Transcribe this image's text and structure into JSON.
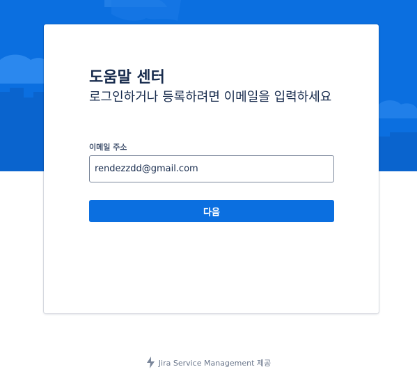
{
  "colors": {
    "brand": "#0b6fe0",
    "text_primary": "#172b4d",
    "text_muted": "#6b778c"
  },
  "header": {
    "title": "도움말 센터",
    "subtitle": "로그인하거나 등록하려면 이메일을 입력하세요"
  },
  "form": {
    "email_label": "이메일 주소",
    "email_value": "rendezzdd@gmail.com",
    "next_label": "다음"
  },
  "footer": {
    "icon": "jira-bolt-icon",
    "text": "Jira Service Management 제공"
  }
}
